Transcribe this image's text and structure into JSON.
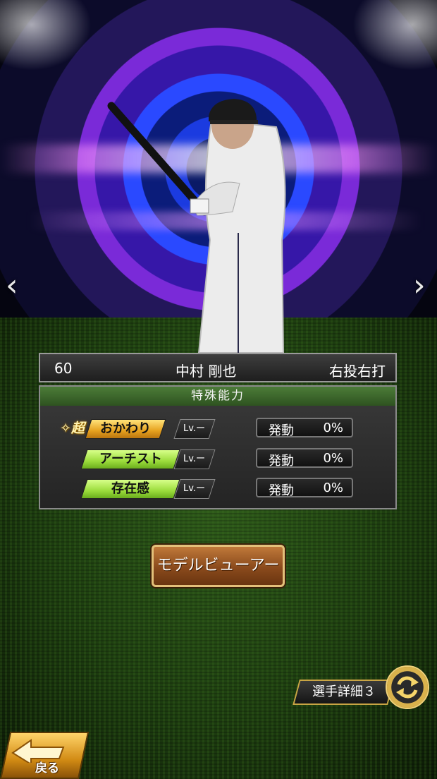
{
  "player": {
    "number": "60",
    "name": "中村 剛也",
    "handedness": "右投右打"
  },
  "abilities": {
    "section_title": "特殊能力",
    "items": [
      {
        "name": "おかわり",
        "badge": "超",
        "lv": "Lv.ー",
        "trigger": "発動",
        "rate": "0%",
        "color": "gold"
      },
      {
        "name": "アーチスト",
        "badge": "",
        "lv": "Lv.ー",
        "trigger": "発動",
        "rate": "0%",
        "color": "green"
      },
      {
        "name": "存在感",
        "badge": "",
        "lv": "Lv.ー",
        "trigger": "発動",
        "rate": "0%",
        "color": "green"
      }
    ]
  },
  "buttons": {
    "model_viewer": "モデルビューアー",
    "player_detail": "選手詳細３",
    "back": "戻る",
    "prev_arrow": "‹",
    "next_arrow": "›"
  },
  "icons": [
    "chevron-left-icon",
    "chevron-right-icon",
    "rotate-icon",
    "back-arrow-icon",
    "sparkle-icon"
  ]
}
